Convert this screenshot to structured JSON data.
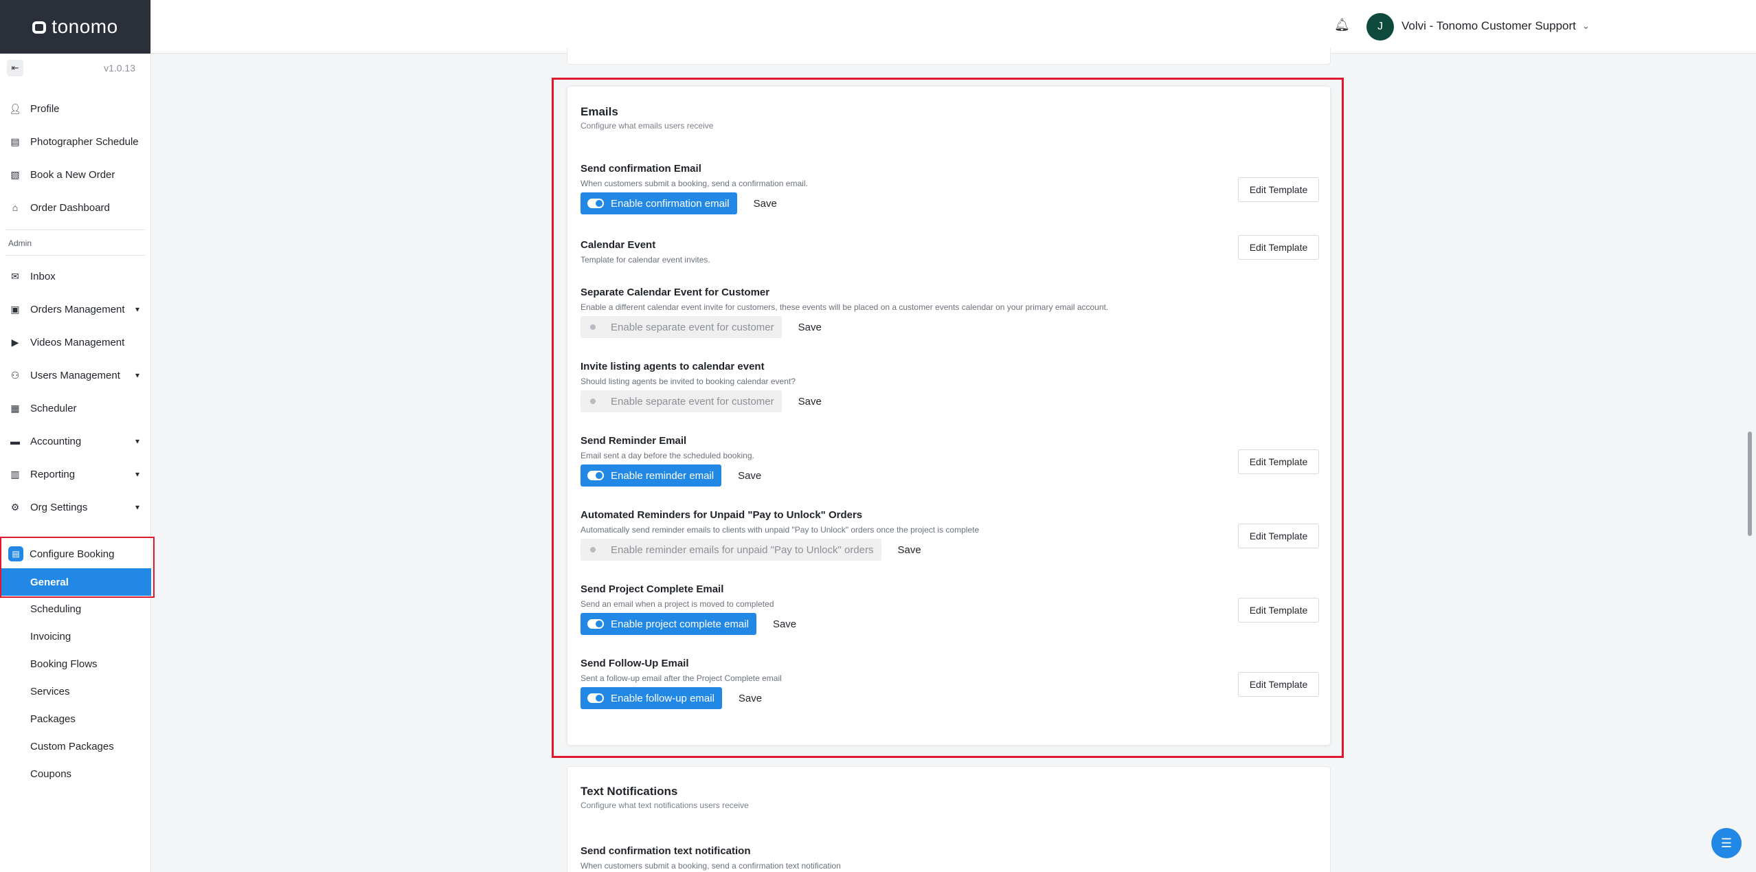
{
  "app": {
    "brand": "tonomo",
    "version": "v1.0.13"
  },
  "topbar": {
    "avatar_initial": "J",
    "user_name": "Volvi - Tonomo Customer Support"
  },
  "sidebar": {
    "items": [
      {
        "label": "Profile",
        "icon": "person-icon"
      },
      {
        "label": "Photographer Schedule",
        "icon": "schedule-icon"
      },
      {
        "label": "Book a New Order",
        "icon": "book-icon"
      },
      {
        "label": "Order Dashboard",
        "icon": "home-icon"
      }
    ],
    "admin_label": "Admin",
    "admin_items": [
      {
        "label": "Inbox",
        "icon": "mail-icon",
        "expandable": false
      },
      {
        "label": "Orders Management",
        "icon": "orders-icon",
        "expandable": true
      },
      {
        "label": "Videos Management",
        "icon": "video-icon",
        "expandable": false
      },
      {
        "label": "Users Management",
        "icon": "users-icon",
        "expandable": true
      },
      {
        "label": "Scheduler",
        "icon": "calendar-icon",
        "expandable": false
      },
      {
        "label": "Accounting",
        "icon": "wallet-icon",
        "expandable": true
      },
      {
        "label": "Reporting",
        "icon": "report-icon",
        "expandable": true
      },
      {
        "label": "Org Settings",
        "icon": "gear-icon",
        "expandable": true
      }
    ],
    "configure_booking": "Configure Booking",
    "active_sub": "General",
    "sub_items": [
      "Scheduling",
      "Invoicing",
      "Booking Flows",
      "Services",
      "Packages",
      "Custom Packages",
      "Coupons"
    ]
  },
  "emails": {
    "title": "Emails",
    "subtitle": "Configure what emails users receive",
    "edit_label": "Edit Template",
    "save_label": "Save",
    "rows": [
      {
        "title": "Send confirmation Email",
        "desc": "When customers submit a booking, send a confirmation email.",
        "toggle": "Enable confirmation email",
        "enabled": true,
        "has_edit": true
      },
      {
        "title": "Calendar Event",
        "desc": "Template for calendar event invites.",
        "toggle": null,
        "enabled": null,
        "has_edit": true
      },
      {
        "title": "Separate Calendar Event for Customer",
        "desc": "Enable a different calendar event invite for customers, these events will be placed on a customer events calendar on your primary email account.",
        "toggle": "Enable separate event for customer",
        "enabled": false,
        "has_edit": false
      },
      {
        "title": "Invite listing agents to calendar event",
        "desc": "Should listing agents be invited to booking calendar event?",
        "toggle": "Enable separate event for customer",
        "enabled": false,
        "has_edit": false
      },
      {
        "title": "Send Reminder Email",
        "desc": "Email sent a day before the scheduled booking.",
        "toggle": "Enable reminder email",
        "enabled": true,
        "has_edit": true
      },
      {
        "title": "Automated Reminders for Unpaid \"Pay to Unlock\" Orders",
        "desc": "Automatically send reminder emails to clients with unpaid \"Pay to Unlock\" orders once the project is complete",
        "toggle": "Enable reminder emails for unpaid \"Pay to Unlock\" orders",
        "enabled": false,
        "has_edit": true
      },
      {
        "title": "Send Project Complete Email",
        "desc": "Send an email when a project is moved to completed",
        "toggle": "Enable project complete email",
        "enabled": true,
        "has_edit": true
      },
      {
        "title": "Send Follow-Up Email",
        "desc": "Sent a follow-up email after the Project Complete email",
        "toggle": "Enable follow-up email",
        "enabled": true,
        "has_edit": true
      }
    ]
  },
  "text_notifications": {
    "title": "Text Notifications",
    "subtitle": "Configure what text notifications users receive",
    "first_row_title": "Send confirmation text notification",
    "first_row_desc": "When customers submit a booking, send a confirmation text notification"
  }
}
